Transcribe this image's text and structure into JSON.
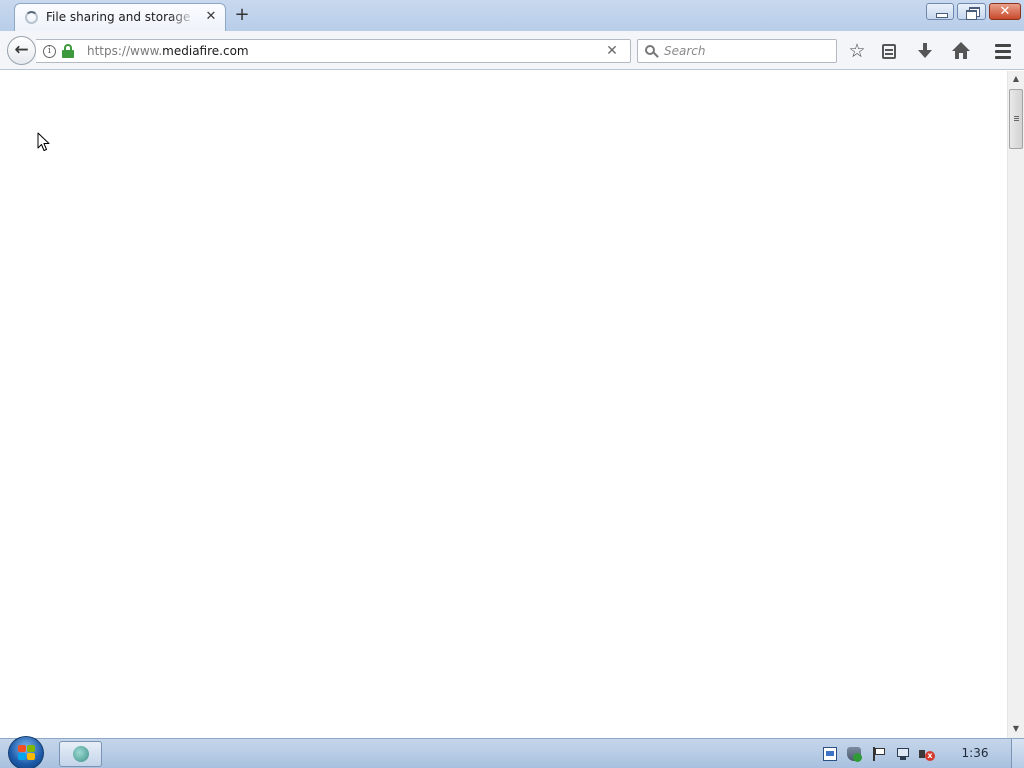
{
  "browser": {
    "tab": {
      "title": "File sharing and storage made simple",
      "close_glyph": "✕",
      "spinner_icon": "loading-spinner-icon"
    },
    "new_tab_glyph": "+",
    "window_controls": {
      "close_glyph": "✕"
    },
    "nav": {
      "back_glyph": "←",
      "url": {
        "prefix": "https://www.",
        "domain": "mediafire.com"
      },
      "url_clear_glyph": "✕",
      "info_glyph": "i",
      "search_placeholder": "Search",
      "bookmark_glyph": "☆"
    }
  },
  "page": {
    "loading": true
  },
  "scrollbar": {
    "up_glyph": "▲",
    "down_glyph": "▼"
  },
  "taskbar": {
    "clock": "1:36",
    "volume_muted_glyph": "x",
    "colors": {
      "flag_red": "#f25022",
      "flag_green": "#7fba00",
      "flag_blue": "#00a4ef",
      "flag_yellow": "#ffb900"
    }
  }
}
